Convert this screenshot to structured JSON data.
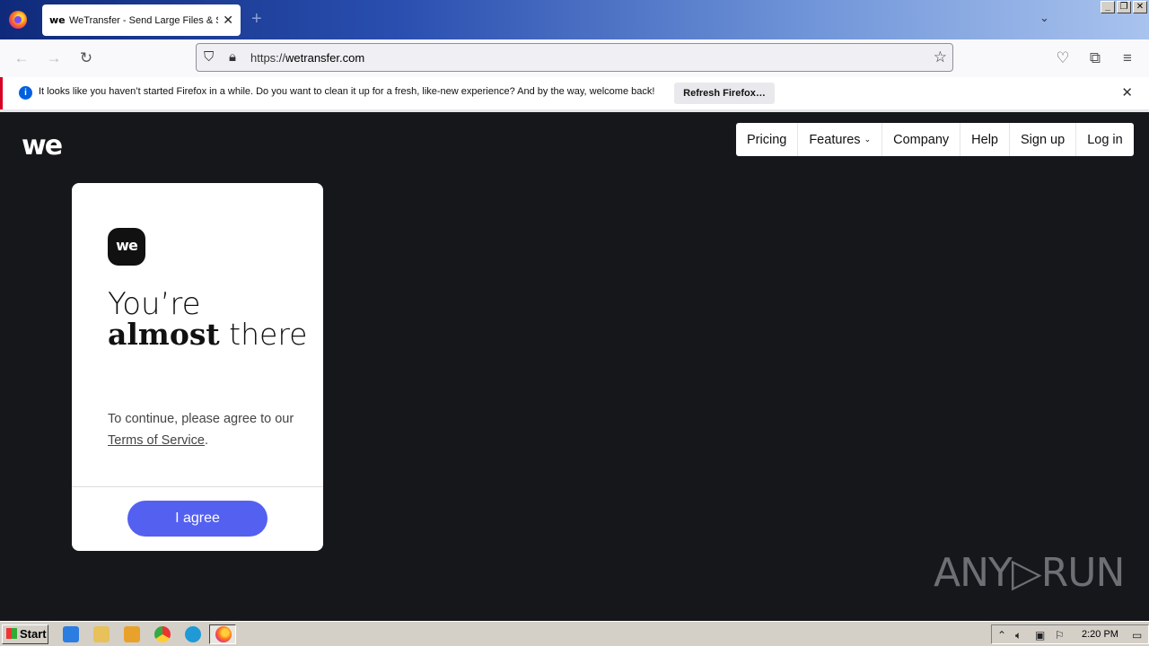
{
  "browser": {
    "tab_title": "WeTransfer - Send Large Files & Sh",
    "tab_favicon": "we",
    "new_tab": "+",
    "url_prefix": "https://",
    "url_host": "wetransfer.com",
    "notification": {
      "message": "It looks like you haven’t started Firefox in a while. Do you want to clean it up for a fresh, like-new experience? And by the way, welcome back!",
      "button": "Refresh Firefox…"
    }
  },
  "site": {
    "logo": "we",
    "nav": [
      "Pricing",
      "Features",
      "Company",
      "Help",
      "Sign up",
      "Log in"
    ],
    "card": {
      "badge": "we",
      "heading_line1": "You’re",
      "heading_bold": "almost",
      "heading_rest": " there",
      "body_text": "To continue, please agree to our ",
      "tos_link": "Terms of Service",
      "body_end": ".",
      "agree_button": "I agree"
    }
  },
  "watermark": "ANY▷RUN",
  "taskbar": {
    "start": "Start",
    "time": "2:20 PM"
  },
  "colors": {
    "page_bg": "#16171b",
    "accent": "#5460f0"
  }
}
